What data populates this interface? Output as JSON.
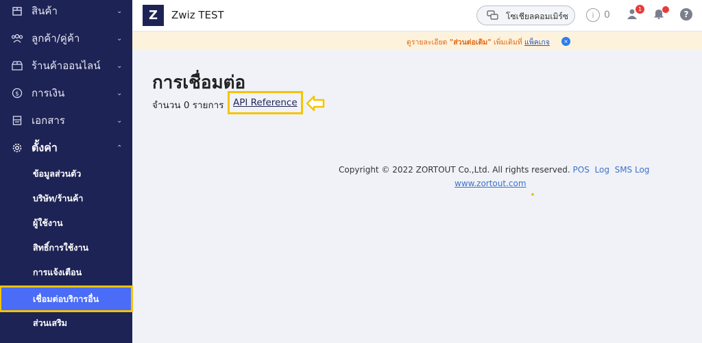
{
  "sidebar": {
    "items": [
      {
        "label": "สินค้า",
        "icon": "box-icon"
      },
      {
        "label": "ลูกค้า/คู่ค้า",
        "icon": "users-icon"
      },
      {
        "label": "ร้านค้าออนไลน์",
        "icon": "shop-icon"
      },
      {
        "label": "การเงิน",
        "icon": "coin-icon"
      },
      {
        "label": "เอกสาร",
        "icon": "document-icon"
      },
      {
        "label": "ตั้งค่า",
        "icon": "gear-icon"
      }
    ],
    "sub_items": [
      {
        "label": "ข้อมูลส่วนตัว"
      },
      {
        "label": "บริษัท/ร้านค้า"
      },
      {
        "label": "ผู้ใช้งาน"
      },
      {
        "label": "สิทธิ์การใช้งาน"
      },
      {
        "label": "การแจ้งเตือน"
      },
      {
        "label": "เชื่อมต่อบริการอื่น"
      },
      {
        "label": "ส่วนเสริม"
      }
    ]
  },
  "header": {
    "logo_text": "Z",
    "brand": "Zwiz TEST",
    "social_button": "โซเชียลคอมเมิร์ซ",
    "info_count": "0",
    "user_badge": "1"
  },
  "notice": {
    "prefix": "ดูรายละเอียด ",
    "highlight": "\"ส่วนต่อเติม\"",
    "middle": " เพิ่มเติมที่ ",
    "link": "แพ็คเกจ",
    "close": "×"
  },
  "main": {
    "title": "การเชื่อมต่อ",
    "count_text": "จำนวน 0 รายการ",
    "api_link": "API Reference"
  },
  "footer": {
    "copyright": "Copyright © 2022 ZORTOUT Co.,Ltd. All rights reserved.",
    "links": [
      "POS",
      "Log",
      "SMS Log"
    ],
    "site": "www.zortout.com"
  },
  "colors": {
    "sidebar_bg": "#1e2355",
    "selected_bg": "#4a6cf7",
    "highlight_outline": "#f5c400",
    "badge_red": "#e83c3c"
  }
}
